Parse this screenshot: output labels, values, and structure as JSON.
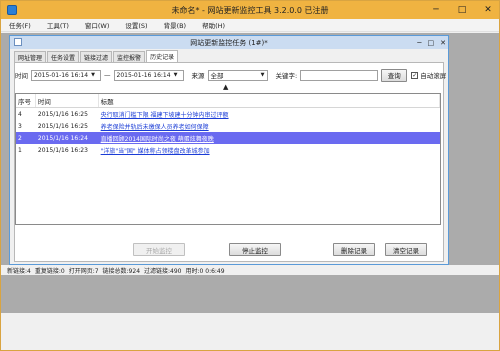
{
  "app": {
    "title": "未命名* - 网站更新监控工具 3.2.0.0 已注册"
  },
  "window_controls": {
    "minimize": "─",
    "maximize": "□",
    "close": "✕"
  },
  "menu": [
    "任务(F)",
    "工具(T)",
    "窗口(W)",
    "设置(S)",
    "背景(B)",
    "帮助(H)"
  ],
  "child_window": {
    "title": "网站更新监控任务 (1#)*",
    "controls": {
      "minimize": "─",
      "maximize": "□",
      "close": "✕"
    }
  },
  "tabs": [
    "网址管理",
    "任务设置",
    "链接过滤",
    "监控报警",
    "历史记录"
  ],
  "active_tab": 4,
  "filter": {
    "time_label": "时间",
    "from": "2015-01-16 16:14",
    "separator": "—",
    "to": "2015-01-16 16:14",
    "source_label": "来源",
    "source_value": "全部",
    "keyword_label": "关键字:",
    "keyword_value": "",
    "query_button": "查询",
    "auto_scroll_label": "自动滚屏",
    "auto_scroll_checked": true
  },
  "history_table": {
    "columns": [
      "序号",
      "时间",
      "标题"
    ],
    "rows": [
      {
        "index": "4",
        "time": "2015/1/16 16:25",
        "title": "央行取消门槛下限 福建下坡建十分钟内审过评额",
        "selected": false
      },
      {
        "index": "3",
        "time": "2015/1/16 16:25",
        "title": "养老保险并轨后未缴保人员养老如何保障",
        "selected": false
      },
      {
        "index": "2",
        "time": "2015/1/16 16:24",
        "title": "直播回顾2014国际时尚之夜 萌蛋炫舞夜晚",
        "selected": true
      },
      {
        "index": "1",
        "time": "2015/1/16 16:23",
        "title": "\"洋旅\"当\"国\" 媒体称占领楼盘改革城参加",
        "selected": false
      }
    ]
  },
  "buttons": {
    "start": "开始监控",
    "stop": "停止监控",
    "delete": "删除记录",
    "clear": "清空记录"
  },
  "status": {
    "new_links": "新链接:4",
    "duplicate_links": "重复链接:0",
    "open_pages": "打开网页:7",
    "total_links": "链接总数:924",
    "filtered_links": "过滤链接:490",
    "time": "用时:0 0:6:49"
  }
}
